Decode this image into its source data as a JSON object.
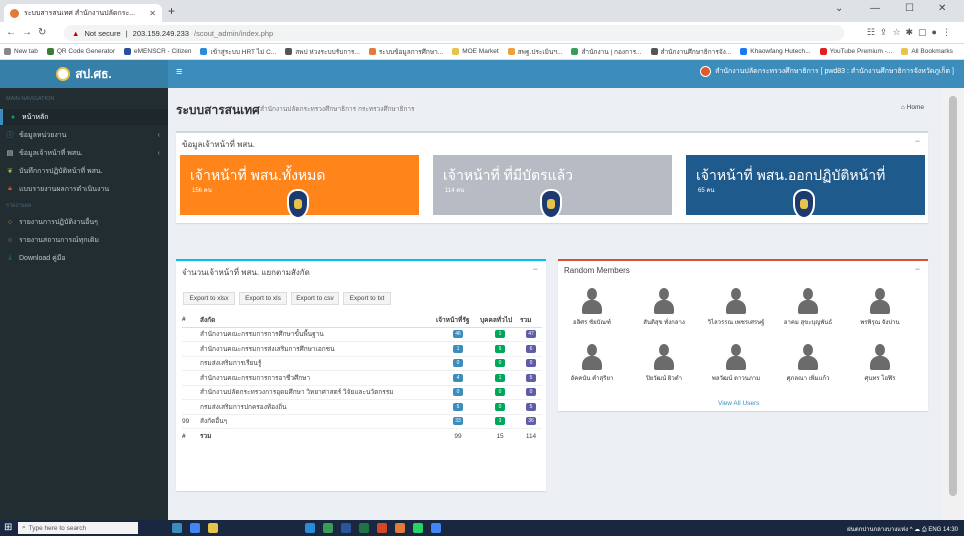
{
  "browser": {
    "tab_title": "ระบบสารสนเทศ สำนักงานปลัดกระ...",
    "url_warning": "Not secure",
    "url_host": "203.159.249.233",
    "url_path": "/scout_admin/index.php",
    "bookmarks": [
      "New tab",
      "QR Code Generator",
      "eMENSCR - Citizen",
      "เข้าสู่ระบบ HRT ไม่ C...",
      "สพป ห่วงระบบรับการ...",
      "ระบบข้อมูลการศึกษา...",
      "MOE Market",
      "สพฐ.ประเมินฯ...",
      "สำนักงาน | กองการ...",
      "สำนักงานศึกษาธิการจัง...",
      "Khaowfang Hutech...",
      "YouTube Premium -...",
      "All Bookmarks"
    ]
  },
  "app": {
    "logo_text": "สป.ศธ.",
    "header_user": "สำนักงานปลัดกระทรวงศึกษาธิการ [ pwd83 : สำนักงานศึกษาธิการจังหวัดภูเก็ต ]"
  },
  "sidebar": {
    "header_main": "MAIN NAVIGATION",
    "items": [
      {
        "label": "หน้าหลัก",
        "icon": "home-icon"
      },
      {
        "label": "ข้อมูลหน่วยงาน",
        "icon": "info-icon"
      },
      {
        "label": "ข้อมูลเจ้าหน้าที่ พสน.",
        "icon": "list-icon"
      },
      {
        "label": "บันทึกการปฏิบัติหน้าที่ พสน.",
        "icon": "leaf-icon"
      },
      {
        "label": "แบบรายงานผลการดำเนินงาน",
        "icon": "lock-icon"
      }
    ],
    "header_report": "รายงานผล",
    "report_items": [
      {
        "label": "รายงานการปฏิบัติงานอื่นๆ"
      },
      {
        "label": "รายงานสถานการณ์ทุกเดิม"
      },
      {
        "label": "Download คู่มือ"
      }
    ]
  },
  "page": {
    "title": "ระบบสารสนเทศ",
    "subtitle": "สำนักงานปลัดกระทรวงศึกษาธิการ กระทรวงศึกษาธิการ",
    "breadcrumb": "Home"
  },
  "officer_box": {
    "title": "ข้อมูลเจ้าหน้าที่ พสน.",
    "cards": [
      {
        "label": "เจ้าหน้าที่ พสน.ทั้งหมด",
        "count": "156 คน",
        "color": "#ff851b"
      },
      {
        "label": "เจ้าหน้าที่ ที่มีบัตรแล้ว",
        "count": "114 คน",
        "color": "#b7bcc4"
      },
      {
        "label": "เจ้าหน้าที่ พสน.ออกปฏิบัติหน้าที่",
        "count": "65 คน",
        "color": "#1f5a8c"
      }
    ]
  },
  "table_box": {
    "title": "จำนวนเจ้าหน้าที่ พสน. แยกตามสังกัด",
    "exports": [
      "Export to xlsx",
      "Export to xls",
      "Export to csv",
      "Export to txt"
    ],
    "headers": [
      "#",
      "สังกัด",
      "เจ้าหน้าที่รัฐ",
      "บุคคลทั่วไป",
      "รวม"
    ],
    "rows": [
      {
        "no": "",
        "name": "สำนักงานคณะกรรมการการศึกษาขั้นพื้นฐาน",
        "gov": "46",
        "gen": "1",
        "total": "47"
      },
      {
        "no": "",
        "name": "สำนักงานคณะกรรมการส่งเสริมการศึกษาเอกชน",
        "gov": "1",
        "gen": "5",
        "total": "6"
      },
      {
        "no": "",
        "name": "กรมส่งเสริมการเรียนรู้",
        "gov": "0",
        "gen": "0",
        "total": "0"
      },
      {
        "no": "",
        "name": "สำนักงานคณะกรรมการการอาชีวศึกษา",
        "gov": "4",
        "gen": "1",
        "total": "5"
      },
      {
        "no": "",
        "name": "สำนักงานปลัดกระทรวงการอุดมศึกษา วิทยาศาสตร์ วิจัยและนวัตกรรม",
        "gov": "0",
        "gen": "0",
        "total": "0"
      },
      {
        "no": "",
        "name": "กรมส่งเสริมการปกครองท้องถิ่น",
        "gov": "5",
        "gen": "0",
        "total": "5"
      },
      {
        "no": "99",
        "name": "สังกัดอื่นๆ",
        "gov": "33",
        "gen": "3",
        "total": "36"
      }
    ],
    "total_row": {
      "no": "#",
      "name": "รวม",
      "gov": "99",
      "gen": "15",
      "total": "114"
    }
  },
  "members_box": {
    "title": "Random Members",
    "members": [
      "อลิศร ชัยบัณฑ์",
      "สันติสุข ทั่งกลาง",
      "วิไลวรรณ เพชรเศรษฐ์",
      "อาคม สุขะบุญพันธ์",
      "พรพิรุณ จังปาน",
      "อัคคนัน คำสุริยา",
      "ปิยวัฒน์ ผิวดำ",
      "พลวัฒน์ ดาวนภาม",
      "ศุภลณา เพิ่มแก้ว",
      "ศุนทร โอฬิร"
    ],
    "view_all": "View All Users"
  },
  "taskbar": {
    "search_placeholder": "Type here to search",
    "tray_text": "ฝนตกปานกลางบางแห่ง",
    "time": "14:30"
  }
}
